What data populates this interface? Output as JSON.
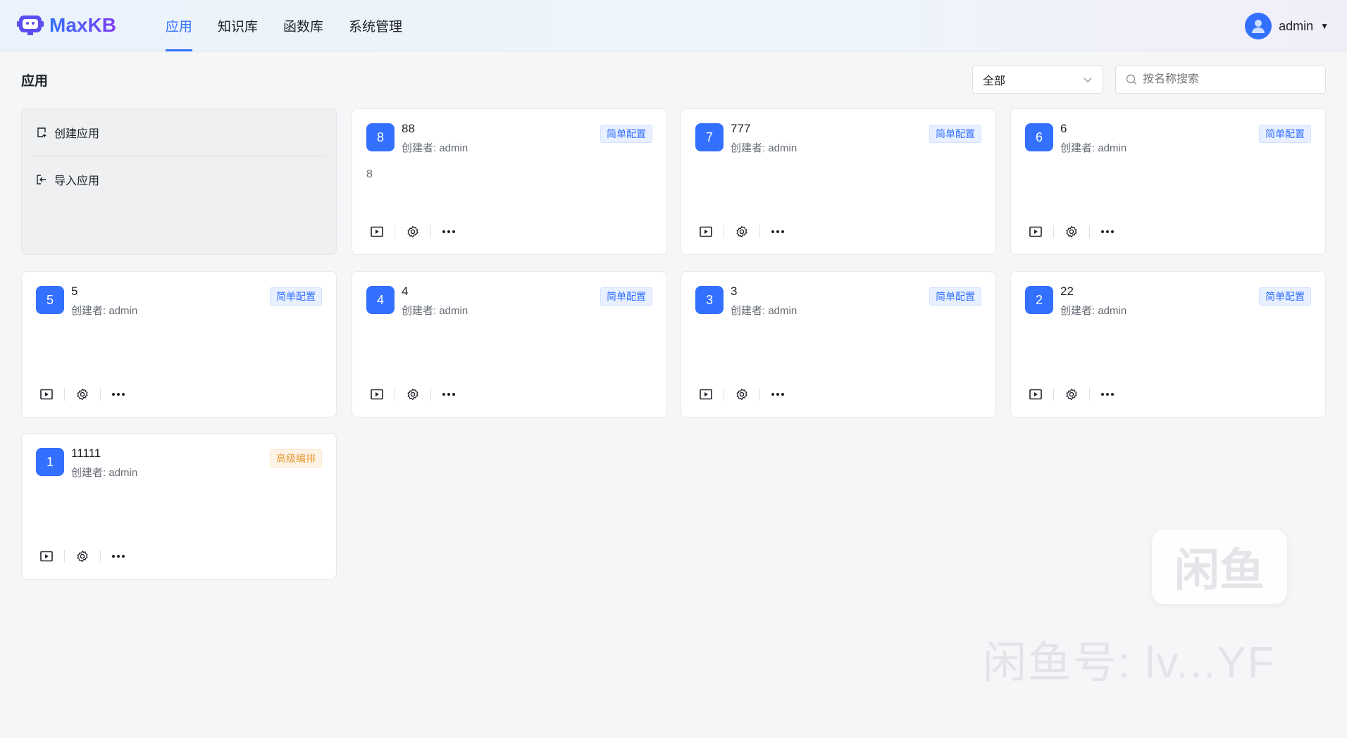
{
  "header": {
    "logo": "MaxKB",
    "nav": [
      "应用",
      "知识库",
      "函数库",
      "系统管理"
    ],
    "active": 0,
    "user": "admin"
  },
  "page": {
    "title": "应用"
  },
  "filter": {
    "selected": "全部",
    "search_placeholder": "按名称搜索"
  },
  "create": {
    "create_label": "创建应用",
    "import_label": "导入应用"
  },
  "apps": [
    {
      "icon": "8",
      "name": "88",
      "creator": "创建者: admin",
      "tag": "简单配置",
      "type": "simple",
      "desc": "8"
    },
    {
      "icon": "7",
      "name": "777",
      "creator": "创建者: admin",
      "tag": "简单配置",
      "type": "simple",
      "desc": ""
    },
    {
      "icon": "6",
      "name": "6",
      "creator": "创建者: admin",
      "tag": "简单配置",
      "type": "simple",
      "desc": ""
    },
    {
      "icon": "5",
      "name": "5",
      "creator": "创建者: admin",
      "tag": "简单配置",
      "type": "simple",
      "desc": ""
    },
    {
      "icon": "4",
      "name": "4",
      "creator": "创建者: admin",
      "tag": "简单配置",
      "type": "simple",
      "desc": ""
    },
    {
      "icon": "3",
      "name": "3",
      "creator": "创建者: admin",
      "tag": "简单配置",
      "type": "simple",
      "desc": ""
    },
    {
      "icon": "2",
      "name": "22",
      "creator": "创建者: admin",
      "tag": "简单配置",
      "type": "simple",
      "desc": ""
    },
    {
      "icon": "1",
      "name": "11111",
      "creator": "创建者: admin",
      "tag": "高级编排",
      "type": "advanced",
      "desc": ""
    }
  ],
  "watermark": {
    "logo": "闲鱼",
    "text": "闲鱼号: lv...YF"
  },
  "colors": {
    "primary": "#3370ff",
    "advanced": "#e59b34"
  }
}
